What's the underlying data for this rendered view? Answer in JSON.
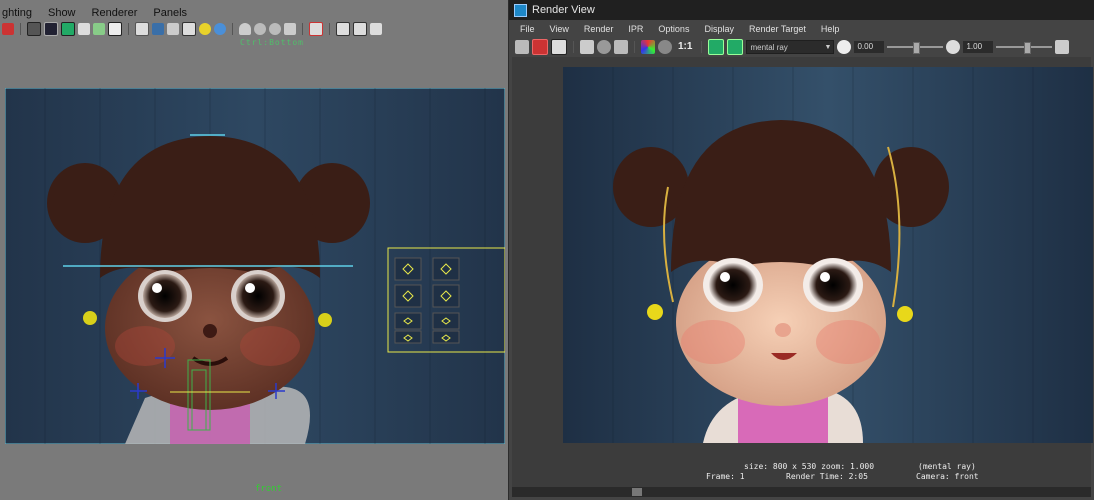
{
  "viewport": {
    "menu": [
      "ghting",
      "Show",
      "Renderer",
      "Panels"
    ],
    "hud_top": "Ctrl:Bottom",
    "camera_label": "front",
    "toolbar_icons": [
      "render-icon",
      "ipr-icon",
      "grid-icon",
      "film-icon",
      "gate-icon",
      "resolution-icon",
      "safe-icon",
      "text-icon",
      "wireframe-icon",
      "shaded-icon",
      "textured-icon",
      "lights-icon",
      "lighting-icon",
      "shadows-icon",
      "xray-icon",
      "isolate-icon",
      "camera-icon",
      "share-icon"
    ]
  },
  "render_view": {
    "title": "Render View",
    "menu": [
      "File",
      "View",
      "Render",
      "IPR",
      "Options",
      "Display",
      "Render Target",
      "Help"
    ],
    "renderer": "mental ray",
    "ratio_label": "1:1",
    "exposure": "0.00",
    "gamma": "1.00",
    "status": {
      "size_line": "size: 800 x 530 zoom: 1.000",
      "renderer_line": "(mental ray)",
      "frame": "Frame: 1",
      "render_time": "Render Time: 2:05",
      "camera": "Camera: front"
    }
  },
  "colors": {
    "viewport_bg": "#7a7a7a",
    "wood_dark": "#1f3045",
    "wood_light": "#34506a",
    "hair": "#3a1e16",
    "accent_green": "#4fbf6a",
    "select_yellow": "#e8e84a"
  }
}
